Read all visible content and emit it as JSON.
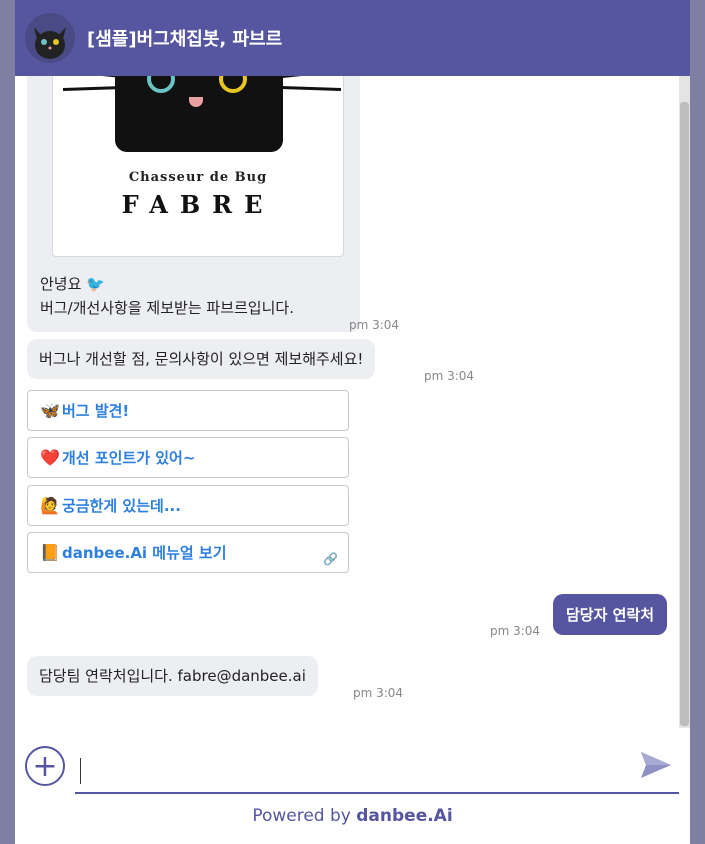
{
  "header": {
    "title": "[샘플]버그채집봇, 파브르"
  },
  "welcome_card": {
    "brand_line1": "Chasseur de Bug",
    "brand_line2": "FABRE"
  },
  "messages": [
    {
      "line1": "안녕요 🐦",
      "line2": "버그/개선사항을 제보받는 파브르입니다.",
      "time": "pm 3:04"
    },
    {
      "text": "버그나 개선할 점, 문의사항이 있으면 제보해주세요!",
      "time": "pm 3:04"
    },
    {
      "text": "담당팀 연락처입니다. fabre@danbee.ai",
      "time": "pm 3:04"
    }
  ],
  "quick_replies": [
    {
      "icon": "🦋",
      "label": "버그 발견!"
    },
    {
      "icon": "❤️",
      "label": "개선 포인트가 있어~"
    },
    {
      "icon": "🙋",
      "label": "궁금한게 있는데..."
    },
    {
      "icon": "📙",
      "label": "danbee.Ai 메뉴얼 보기",
      "link_icon": "🔗"
    }
  ],
  "user_message": {
    "text": "담당자 연락처",
    "time": "pm 3:04"
  },
  "input": {
    "placeholder": ""
  },
  "footer": {
    "powered_prefix": "Powered by ",
    "powered_brand": "danbee.Ai"
  },
  "colors": {
    "accent": "#5656a0",
    "link": "#2d7fe0",
    "bubble_bg": "#edeef2"
  }
}
